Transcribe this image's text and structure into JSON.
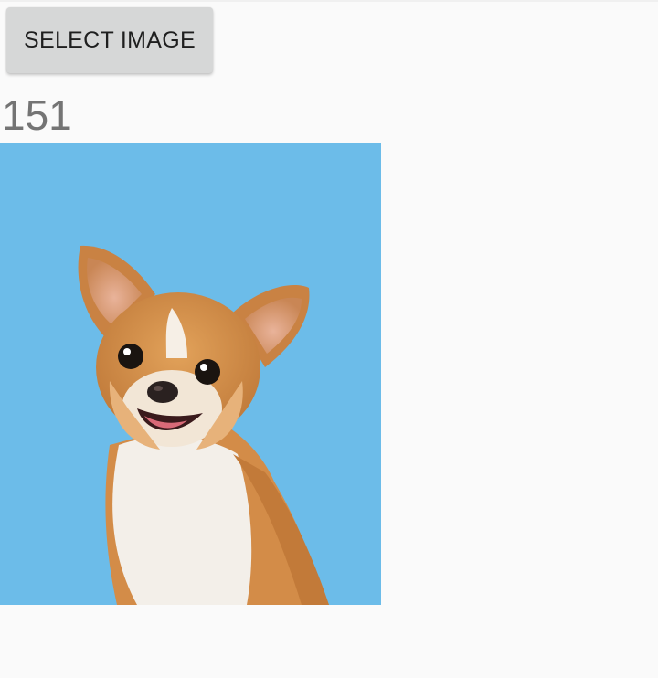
{
  "toolbar": {
    "select_image_label": "SELECT IMAGE"
  },
  "result": {
    "count": "151"
  },
  "photo": {
    "subject": "chihuahua-dog",
    "background_color": "#6cbce9"
  }
}
